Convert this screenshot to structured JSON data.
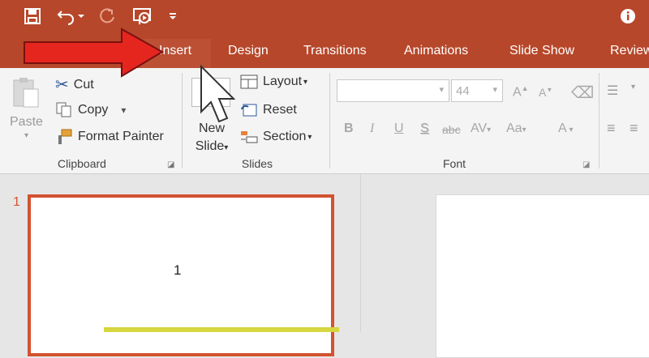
{
  "qat": {
    "save": "save-icon",
    "undo": "undo-icon",
    "redo": "redo-icon",
    "slideshow": "slideshow-icon",
    "customize": "customize-qat-icon",
    "info": "info-icon"
  },
  "tabs": [
    "Insert",
    "Design",
    "Transitions",
    "Animations",
    "Slide Show",
    "Review"
  ],
  "clipboard": {
    "paste": "Paste",
    "cut": "Cut",
    "copy": "Copy",
    "format_painter": "Format Painter",
    "group": "Clipboard"
  },
  "slides": {
    "new_slide_line1": "New",
    "new_slide_line2": "Slide",
    "layout": "Layout",
    "reset": "Reset",
    "section": "Section",
    "group": "Slides"
  },
  "font": {
    "size": "44",
    "group": "Font",
    "bold": "B",
    "italic": "I",
    "underline": "U",
    "shadow": "S",
    "strike": "abc",
    "spacing": "AV",
    "case": "Aa",
    "color": "A",
    "grow": "A",
    "shrink": "A"
  },
  "thumbnail": {
    "index": "1",
    "title": "1"
  },
  "colors": {
    "accent": "#b7472a",
    "selection": "#d35230",
    "arrow": "#e5261f"
  }
}
